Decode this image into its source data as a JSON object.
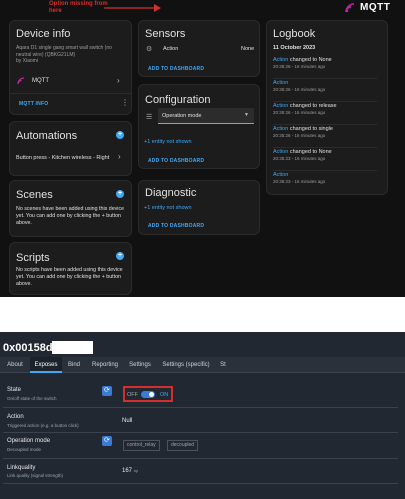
{
  "annotation": {
    "line1": "Option missing from",
    "line2": "here"
  },
  "brand": {
    "name": "MQTT"
  },
  "device_info": {
    "title": "Device info",
    "model": "Aqara D1 single gang smart wall switch (no neutral wire) (QBKG21LM)",
    "by": "by Xiaomi",
    "integration": "MQTT",
    "mqtt_info": "MQTT INFO"
  },
  "automations": {
    "title": "Automations",
    "item": "Button press - Kitchen wireless - Right"
  },
  "scenes": {
    "title": "Scenes",
    "text": "No scenes have been added using this device yet. You can add one by clicking the + button above."
  },
  "scripts": {
    "title": "Scripts",
    "text": "No scripts have been added using this device yet. You can add one by clicking the + button above."
  },
  "sensors": {
    "title": "Sensors",
    "entity": "Action",
    "state": "None",
    "add": "ADD TO DASHBOARD"
  },
  "configuration": {
    "title": "Configuration",
    "select_label": "Operation mode",
    "hidden": "+1 entity not shown",
    "add": "ADD TO DASHBOARD"
  },
  "diagnostic": {
    "title": "Diagnostic",
    "hidden": "+1 entity not shown",
    "add": "ADD TO DASHBOARD"
  },
  "logbook": {
    "title": "Logbook",
    "date": "11 October 2023",
    "entries": [
      {
        "entity": "Action",
        "text": "changed to None",
        "time": "20:35:26 - 16 minutes ago"
      },
      {
        "entity": "Action",
        "text": "",
        "time": "20:35:26 - 16 minutes ago"
      },
      {
        "entity": "Action",
        "text": "changed to release",
        "time": "20:35:26 - 16 minutes ago"
      },
      {
        "entity": "Action",
        "text": "changed to single",
        "time": "20:35:26 - 16 minutes ago"
      },
      {
        "entity": "Action",
        "text": "changed to None",
        "time": "20:35:23 - 16 minutes ago"
      },
      {
        "entity": "Action",
        "text": "",
        "time": "20:35:23 - 16 minutes ago"
      }
    ]
  },
  "z2m": {
    "title": "0x00158d000",
    "tabs": [
      "About",
      "Exposes",
      "Bind",
      "Reporting",
      "Settings",
      "Settings (specific)",
      "St"
    ],
    "state": {
      "label": "State",
      "desc": "On/off state of the switch",
      "off": "OFF",
      "on": "ON"
    },
    "action": {
      "label": "Action",
      "desc": "Triggered action (e.g. a button click)",
      "value": "Null"
    },
    "operation_mode": {
      "label": "Operation mode",
      "desc": "Decoupled mode",
      "opt1": "control_relay",
      "opt2": "decoupled"
    },
    "linkquality": {
      "label": "Linkquality",
      "desc": "Link quality (signal strength)",
      "value": "167",
      "unit": "lqi"
    }
  }
}
